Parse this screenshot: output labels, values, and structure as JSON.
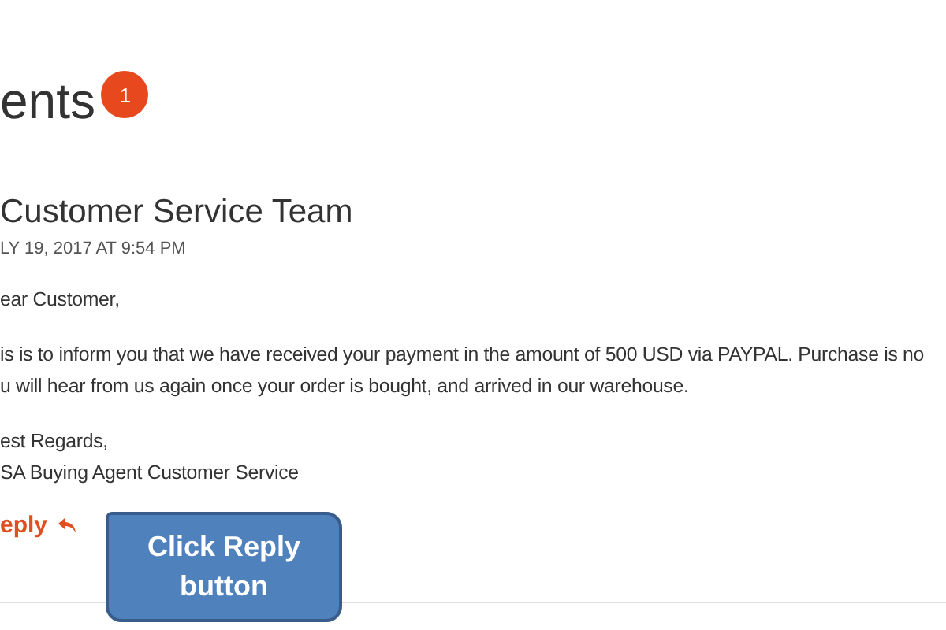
{
  "heading": {
    "title": "ents",
    "badge": "1"
  },
  "comment": {
    "author": "Customer Service Team",
    "date": "LY 19, 2017 AT 9:54 PM",
    "paragraphs": [
      [
        "ear Customer,"
      ],
      [
        "is is to inform you that we have received your payment in the amount of 500 USD via PAYPAL. Purchase is no",
        "u will hear from us again once your order is bought, and arrived in our warehouse."
      ],
      [
        "est Regards,",
        "SA Buying Agent Customer Service"
      ]
    ],
    "reply": "eply"
  },
  "callout": {
    "text": "Click Reply button"
  }
}
